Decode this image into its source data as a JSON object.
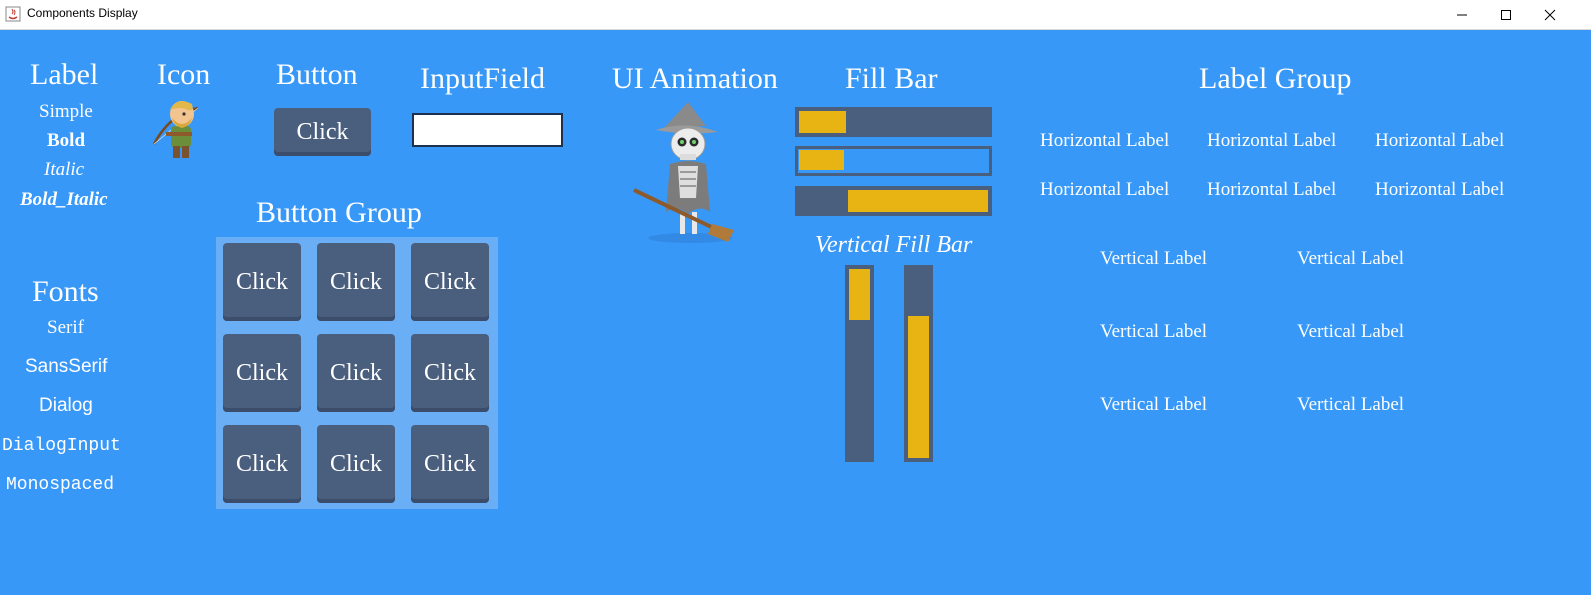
{
  "window": {
    "title": "Components Display"
  },
  "label_section": {
    "header": "Label",
    "items": [
      "Simple",
      "Bold",
      "Italic",
      "Bold_Italic"
    ]
  },
  "icon_section": {
    "header": "Icon"
  },
  "button_section": {
    "header": "Button",
    "button_label": "Click"
  },
  "input_section": {
    "header": "InputField",
    "value": ""
  },
  "animation_section": {
    "header": "UI Animation"
  },
  "fillbar_section": {
    "header": "Fill Bar",
    "horizontal": [
      0.25,
      0.24,
      0.74
    ],
    "vertical_header": "Vertical Fill Bar",
    "vertical": [
      0.27,
      0.75
    ],
    "fill_color": "#e8b414",
    "track_color": "#4a5e7e"
  },
  "fonts_section": {
    "header": "Fonts",
    "items": [
      "Serif",
      "SansSerif",
      "Dialog",
      "DialogInput",
      "Monospaced"
    ]
  },
  "button_group": {
    "header": "Button Group",
    "buttons": [
      "Click",
      "Click",
      "Click",
      "Click",
      "Click",
      "Click",
      "Click",
      "Click",
      "Click"
    ]
  },
  "label_group": {
    "header": "Label Group",
    "horizontal": [
      "Horizontal Label",
      "Horizontal Label",
      "Horizontal Label",
      "Horizontal Label",
      "Horizontal Label",
      "Horizontal Label"
    ],
    "vertical": [
      "Vertical Label",
      "Vertical Label",
      "Vertical Label",
      "Vertical Label",
      "Vertical Label",
      "Vertical Label"
    ]
  },
  "colors": {
    "background": "#3898f8",
    "button": "#4a5e7e",
    "accent": "#e8b414"
  }
}
